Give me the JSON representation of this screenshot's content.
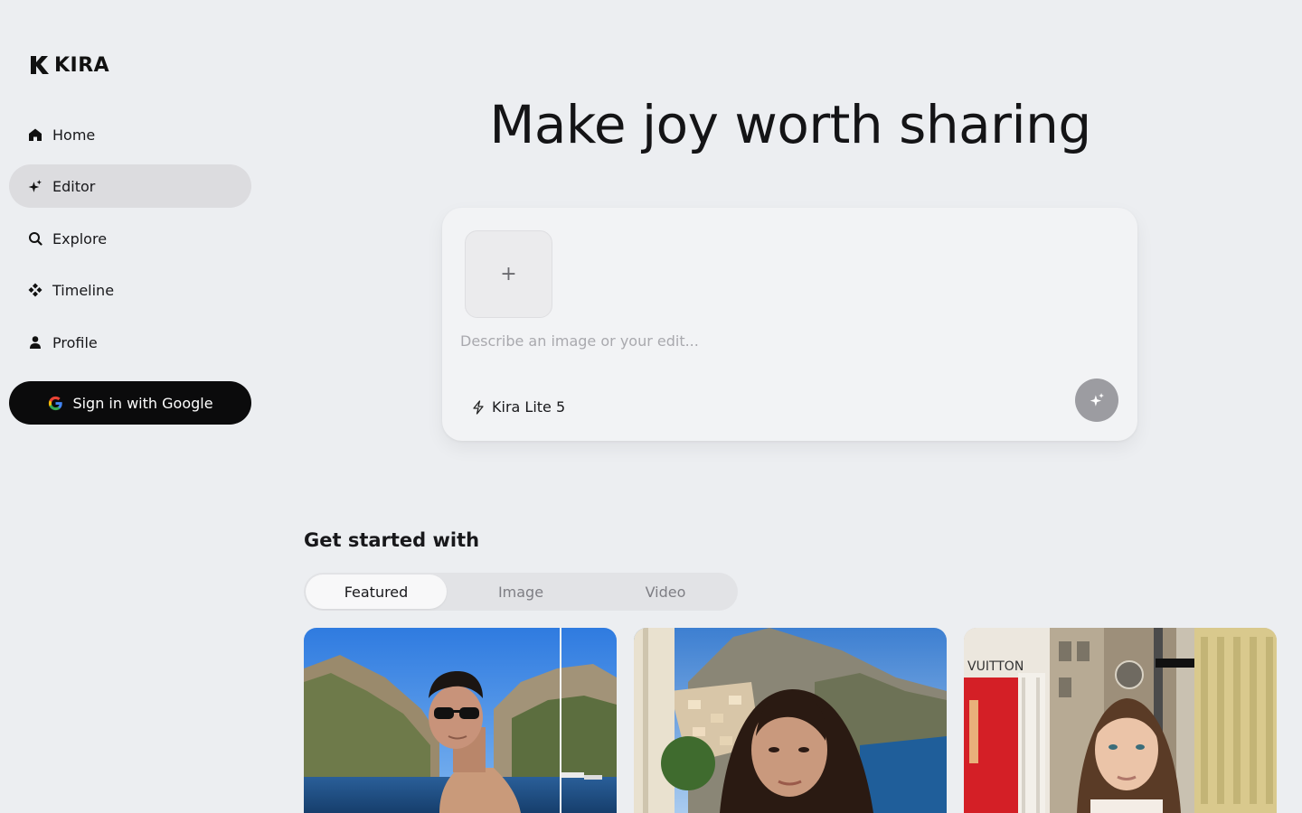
{
  "brand": {
    "name": "KIRA"
  },
  "sidebar": {
    "items": [
      {
        "label": "Home",
        "icon": "home-icon"
      },
      {
        "label": "Editor",
        "icon": "sparkle-icon",
        "active": true
      },
      {
        "label": "Explore",
        "icon": "search-icon"
      },
      {
        "label": "Timeline",
        "icon": "diamond-cluster-icon"
      },
      {
        "label": "Profile",
        "icon": "person-icon"
      }
    ],
    "signin_label": "Sign in with Google"
  },
  "hero": {
    "title": "Make joy worth sharing"
  },
  "composer": {
    "add_image_label": "+",
    "placeholder": "Describe an image or your edit...",
    "model_label": "Kira Lite 5"
  },
  "gallery": {
    "section_title": "Get started with",
    "tabs": [
      {
        "label": "Featured",
        "active": true
      },
      {
        "label": "Image"
      },
      {
        "label": "Video"
      }
    ],
    "cards": [
      {
        "scene": "man-with-sunglasses-on-rocky-coast"
      },
      {
        "scene": "woman-on-cliffside-village"
      },
      {
        "scene": "woman-on-city-street-louis-vuitton",
        "sign_text": "VUITTON"
      }
    ]
  },
  "colors": {
    "background": "#eceef1",
    "active_nav": "#dcdcdf",
    "signin_button": "#0b0b0c",
    "generate_button": "#9c9ca1"
  }
}
